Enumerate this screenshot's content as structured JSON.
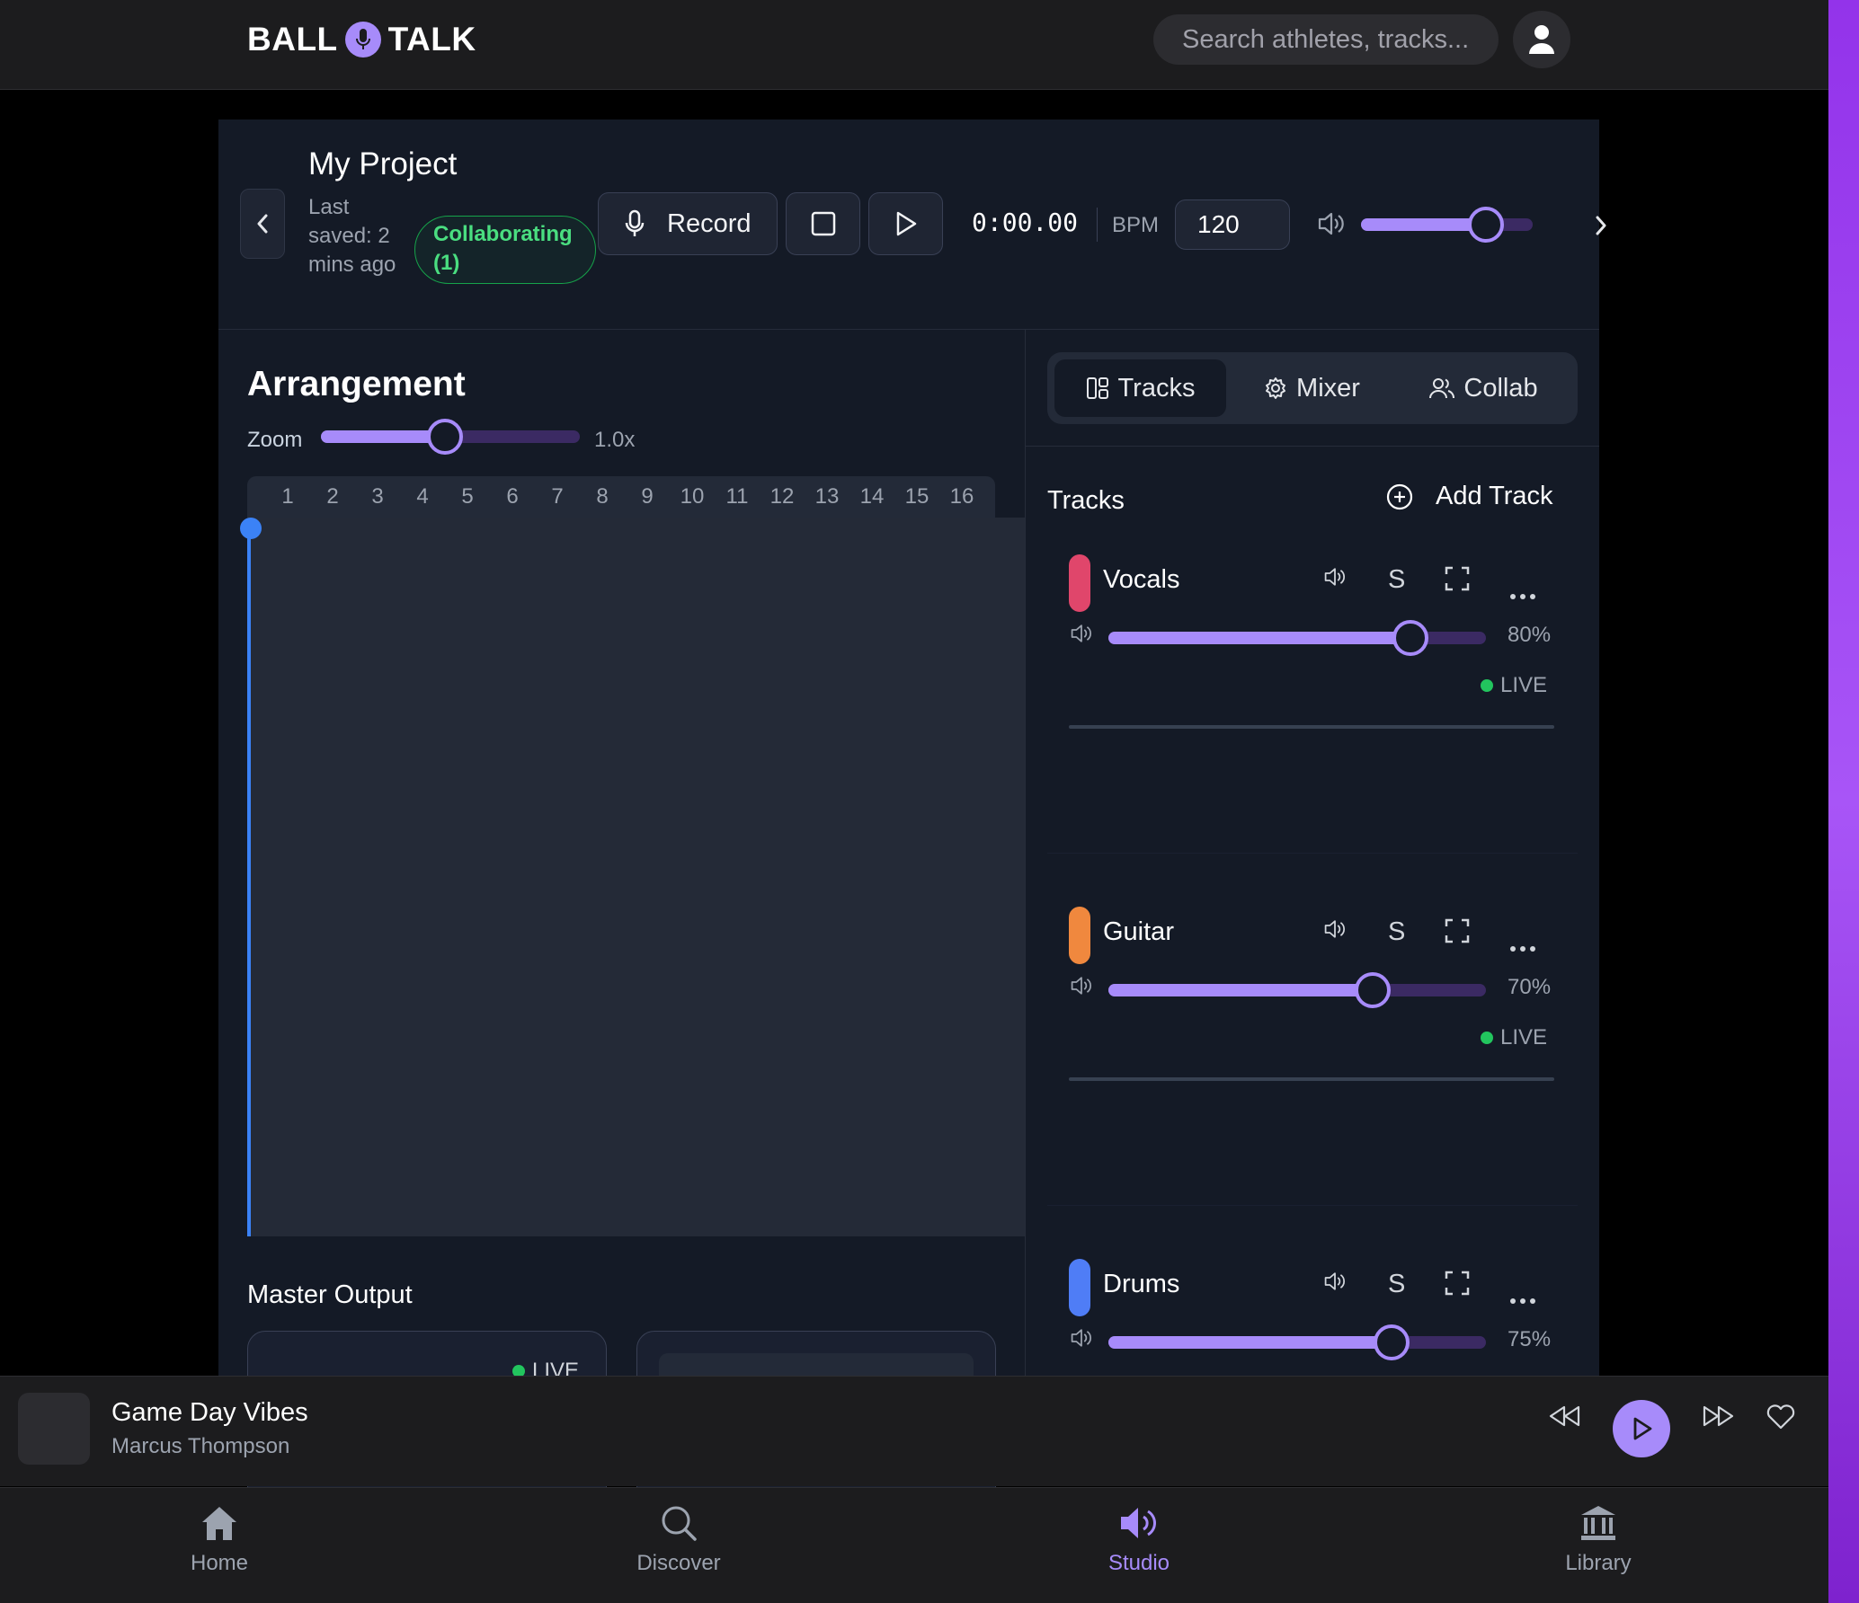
{
  "header": {
    "logo_left": "BALL",
    "logo_right": "TALK",
    "search_placeholder": "Search athletes, tracks..."
  },
  "project": {
    "title": "My Project",
    "last_saved": "Last saved: 2 mins ago",
    "collab_badge": "Collaborating (1)",
    "record_label": "Record",
    "time": "0:00.00",
    "bpm_label": "BPM",
    "bpm_value": "120",
    "master_volume_fraction": 0.73
  },
  "arrangement": {
    "title": "Arrangement",
    "zoom_label": "Zoom",
    "zoom_value": "1.0x",
    "zoom_fraction": 0.48,
    "bars": [
      "1",
      "2",
      "3",
      "4",
      "5",
      "6",
      "7",
      "8",
      "9",
      "10",
      "11",
      "12",
      "13",
      "14",
      "15",
      "16"
    ],
    "master_output_title": "Master Output",
    "master_live": "LIVE"
  },
  "panel": {
    "tabs": [
      {
        "label": "Tracks",
        "icon": "layout-icon",
        "active": true
      },
      {
        "label": "Mixer",
        "icon": "gear-icon",
        "active": false
      },
      {
        "label": "Collab",
        "icon": "users-icon",
        "active": false
      }
    ],
    "tracks_heading": "Tracks",
    "add_track_label": "Add Track",
    "solo_label": "S",
    "live_label": "LIVE",
    "tracks": [
      {
        "name": "Vocals",
        "color": "#e0466b",
        "volume": "80%",
        "volume_fraction": 0.8
      },
      {
        "name": "Guitar",
        "color": "#f0883e",
        "volume": "70%",
        "volume_fraction": 0.7
      },
      {
        "name": "Drums",
        "color": "#4f7df6",
        "volume": "75%",
        "volume_fraction": 0.75
      }
    ]
  },
  "player": {
    "title": "Game Day Vibes",
    "artist": "Marcus Thompson"
  },
  "nav": {
    "items": [
      {
        "label": "Home",
        "icon": "home-icon",
        "active": false
      },
      {
        "label": "Discover",
        "icon": "search-icon",
        "active": false
      },
      {
        "label": "Studio",
        "icon": "speaker-icon",
        "active": true
      },
      {
        "label": "Library",
        "icon": "library-icon",
        "active": false
      }
    ]
  },
  "colors": {
    "accent": "#a78bfa",
    "live": "#22c55e",
    "playhead": "#3b82f6"
  }
}
